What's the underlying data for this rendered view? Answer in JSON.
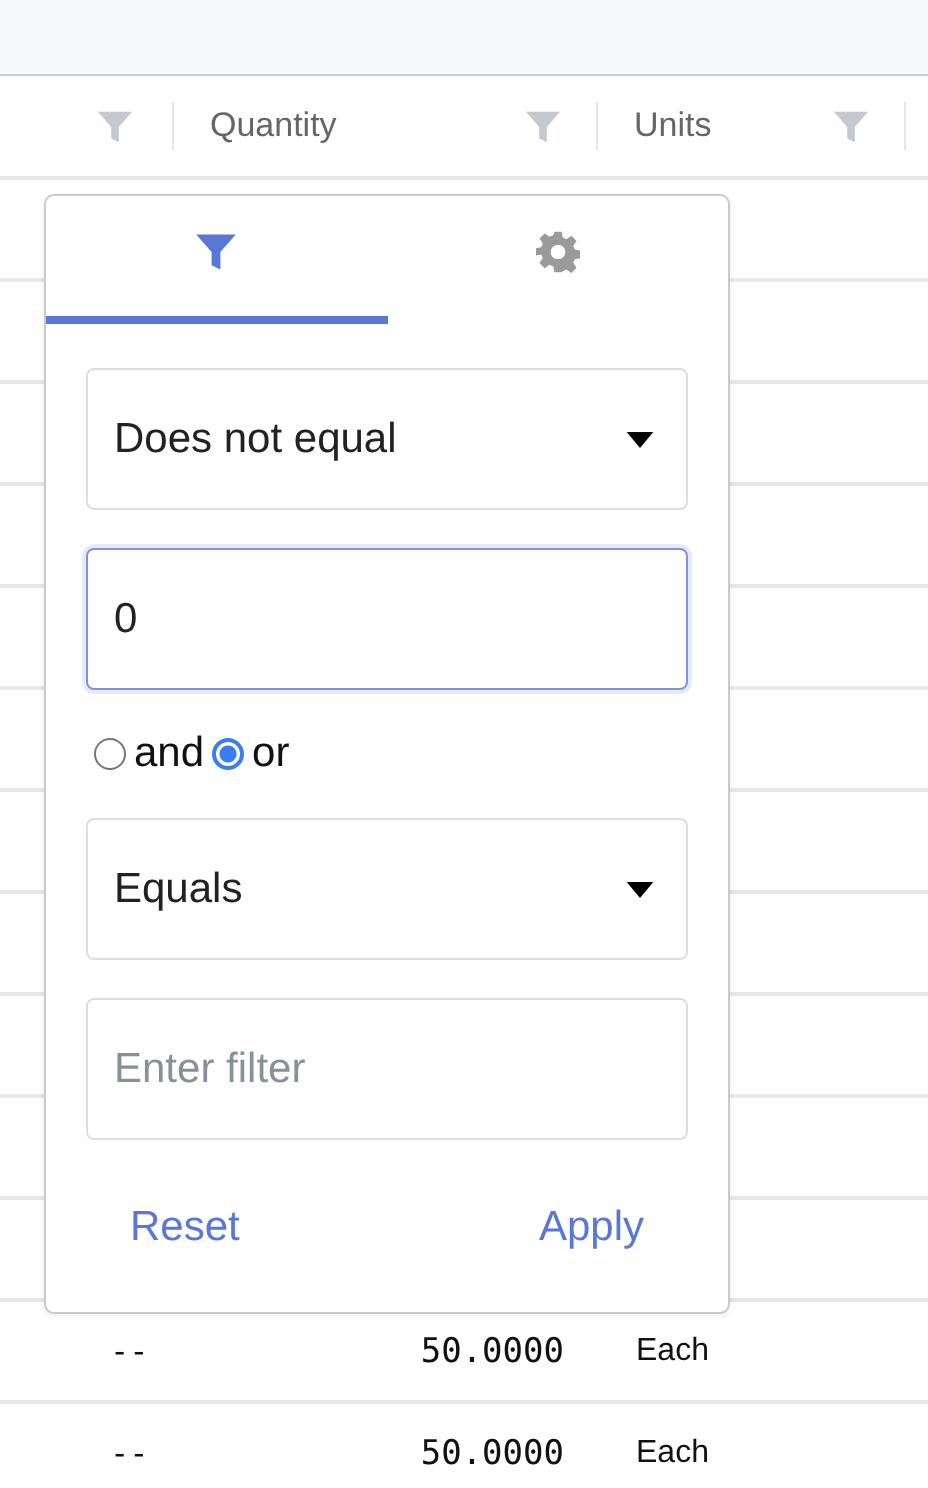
{
  "table": {
    "columns": [
      {},
      {
        "label": "Quantity"
      },
      {
        "label": "Units"
      }
    ],
    "rows": [
      {},
      {},
      {},
      {},
      {},
      {},
      {},
      {},
      {},
      {},
      {},
      {
        "column_1": "--",
        "quantity": "50.0000",
        "units": "Each"
      },
      {
        "column_1": "--",
        "quantity": "50.0000",
        "units": "Each"
      }
    ]
  },
  "filter_popup": {
    "tabs": [
      {
        "kind": "filter",
        "selected": true
      },
      {
        "kind": "settings",
        "selected": false
      }
    ],
    "condition_1": {
      "value": "Does not equal"
    },
    "value_1": {
      "value": "0"
    },
    "join": [
      {
        "label": "and",
        "selected": false
      },
      {
        "label": "or",
        "selected": true
      }
    ],
    "condition_2": {
      "value": "Equals"
    },
    "value_2": {
      "placeholder": "Enter filter"
    },
    "buttons": [
      "Reset",
      "Apply"
    ]
  }
}
